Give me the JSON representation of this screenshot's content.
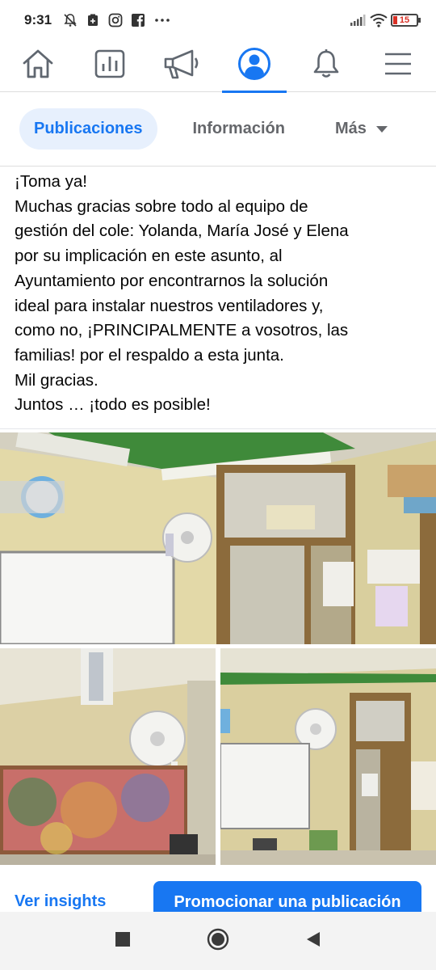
{
  "status_bar": {
    "time": "9:31",
    "battery_level": "15",
    "icons": [
      "mute-icon",
      "notification-icon",
      "instagram-icon",
      "facebook-icon",
      "more-dots-icon",
      "signal-icon",
      "wifi-icon",
      "battery-icon"
    ]
  },
  "nav": {
    "items": [
      {
        "name": "home-icon"
      },
      {
        "name": "insights-icon"
      },
      {
        "name": "megaphone-icon"
      },
      {
        "name": "profile-icon",
        "active": true
      },
      {
        "name": "bell-icon"
      },
      {
        "name": "menu-icon"
      }
    ],
    "accent_color": "#1877f2"
  },
  "tabs": {
    "posts": "Publicaciones",
    "info": "Información",
    "more": "Más"
  },
  "post": {
    "lines": [
      "¡Toma ya!",
      "Muchas gracias sobre todo al equipo de",
      "gestión del cole: Yolanda,  María José  y Elena",
      "por su implicación en este asunto, al",
      "Ayuntamiento por encontrarnos la solución",
      "ideal para instalar nuestros ventiladores  y,",
      "como no, ¡PRINCIPALMENTE a vosotros, las",
      "familias! por el respaldo a esta junta.",
      "Mil gracias.",
      "Juntos … ¡todo es posible!"
    ]
  },
  "actions": {
    "insights": "Ver insights",
    "promote": "Promocionar una publicación"
  },
  "system_nav": [
    "recents-icon",
    "home-circle-icon",
    "back-icon"
  ]
}
